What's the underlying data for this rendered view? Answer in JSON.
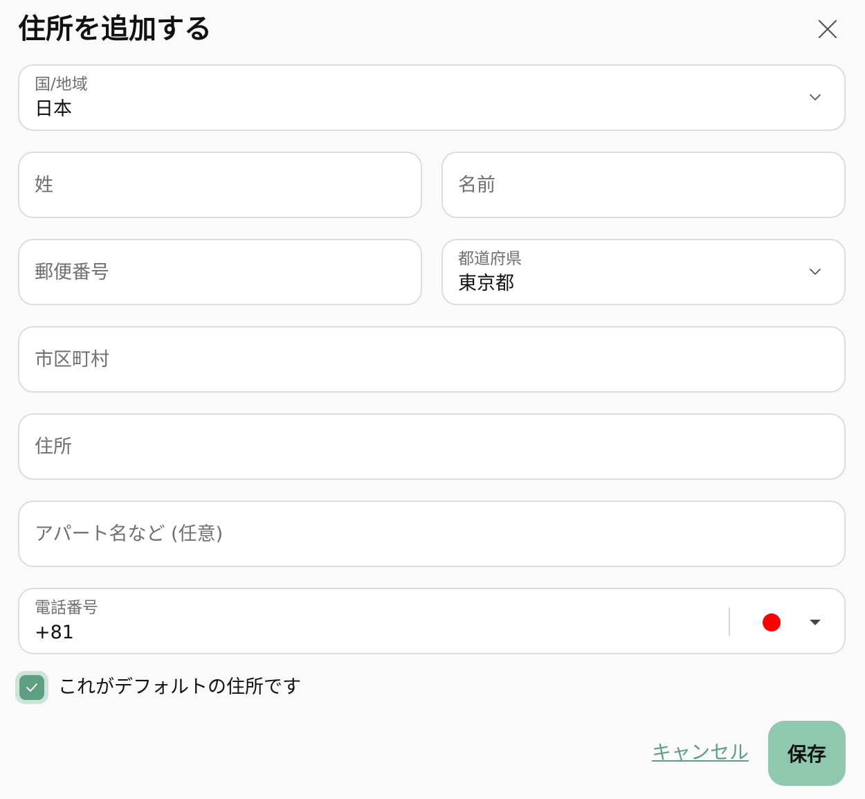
{
  "dialog": {
    "title": "住所を追加する"
  },
  "fields": {
    "country": {
      "label": "国/地域",
      "value": "日本"
    },
    "last_name": {
      "placeholder": "姓"
    },
    "first_name": {
      "placeholder": "名前"
    },
    "postal_code": {
      "placeholder": "郵便番号"
    },
    "prefecture": {
      "label": "都道府県",
      "value": "東京都"
    },
    "city": {
      "placeholder": "市区町村"
    },
    "address": {
      "placeholder": "住所"
    },
    "apartment": {
      "placeholder": "アパート名など (任意)"
    },
    "phone": {
      "label": "電話番号",
      "value": "+81",
      "flag_color": "#ff0000"
    }
  },
  "default_checkbox": {
    "label": "これがデフォルトの住所です",
    "checked": true
  },
  "actions": {
    "cancel_label": "キャンセル",
    "save_label": "保存"
  },
  "colors": {
    "accent": "#5e9f84",
    "save_bg": "#8ec8ae"
  }
}
